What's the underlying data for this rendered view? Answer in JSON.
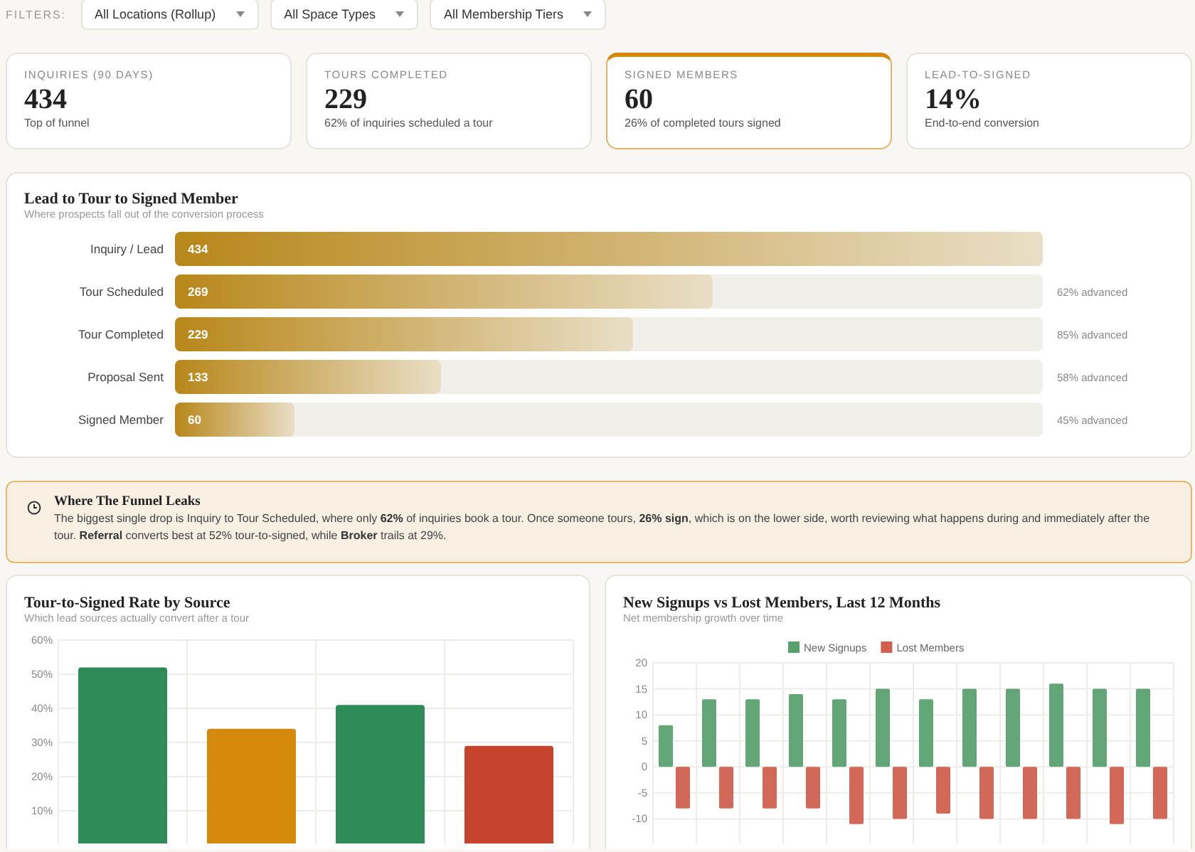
{
  "filters": {
    "label": "FILTERS:",
    "dropdowns": [
      {
        "value": "All Locations (Rollup)"
      },
      {
        "value": "All Space Types"
      },
      {
        "value": "All Membership Tiers"
      }
    ]
  },
  "kpis": [
    {
      "label": "INQUIRIES (90 DAYS)",
      "value": "434",
      "note": "Top of funnel",
      "selected": false
    },
    {
      "label": "TOURS COMPLETED",
      "value": "229",
      "note": "62% of inquiries scheduled a tour",
      "selected": false
    },
    {
      "label": "SIGNED MEMBERS",
      "value": "60",
      "note": "26% of completed tours signed",
      "selected": true
    },
    {
      "label": "LEAD-TO-SIGNED",
      "value": "14%",
      "note": "End-to-end conversion",
      "selected": false
    }
  ],
  "funnel": {
    "title": "Lead to Tour to Signed Member",
    "subtitle": "Where prospects fall out of the conversion process",
    "stages": [
      {
        "name": "Inquiry / Lead",
        "count": "434",
        "level": 1.0
      },
      {
        "name": "Tour Scheduled",
        "count": "269",
        "level": 0.62,
        "advanced": "62% advanced"
      },
      {
        "name": "Tour Completed",
        "count": "229",
        "level": 0.528,
        "advanced": "85% advanced"
      },
      {
        "name": "Proposal Sent",
        "count": "133",
        "level": 0.306,
        "advanced": "58% advanced"
      },
      {
        "name": "Signed Member",
        "count": "60",
        "level": 0.138,
        "advanced": "45% advanced"
      }
    ]
  },
  "insight": {
    "title": "Where The Funnel Leaks",
    "text": "The biggest single drop is Inquiry to Tour Scheduled, where only **62%** of inquiries book a tour. Once someone tours, **26% sign**, which is on the lower side, worth reviewing what happens during and immediately after the tour. **Referral** converts best at 52% tour-to-signed, while **Broker** trails at 29%."
  },
  "charts": [
    {
      "title": "Tour-to-Signed Rate by Source",
      "subtitle": "Which lead sources actually convert after a tour",
      "chart_data": {
        "type": "bar",
        "grid": true,
        "values": [
          52,
          34,
          41,
          29
        ],
        "colors": [
          "#2e8b57",
          "#d4880c",
          "#2e8b57",
          "#c4442e"
        ],
        "ylim": [
          0,
          60
        ],
        "yticks": [
          {
            "value": 10,
            "label": "10%"
          },
          {
            "value": 20,
            "label": "20%"
          },
          {
            "value": 30,
            "label": "30%"
          },
          {
            "value": 40,
            "label": "40%"
          },
          {
            "value": 50,
            "label": "50%"
          },
          {
            "value": 60,
            "label": "60%"
          }
        ]
      }
    },
    {
      "title": "New Signups vs Lost Members, Last 12 Months",
      "subtitle": "Net membership growth over time",
      "chart_data": {
        "type": "bar",
        "grid": true,
        "legend": "top",
        "ylim": [
          -15,
          20
        ],
        "yticks": [
          -10,
          -5,
          0,
          5,
          10,
          15,
          20
        ],
        "series": [
          {
            "name": "New Signups",
            "color": "#5aa06f",
            "values": [
              8,
              13,
              13,
              14,
              13,
              15,
              13,
              15,
              15,
              16,
              15,
              15
            ]
          },
          {
            "name": "Lost Members",
            "color": "#d0604e",
            "values": [
              -8,
              -8,
              -8,
              -8,
              -11,
              -10,
              -9,
              -10,
              -10,
              -10,
              -11,
              -10
            ]
          }
        ]
      }
    }
  ]
}
